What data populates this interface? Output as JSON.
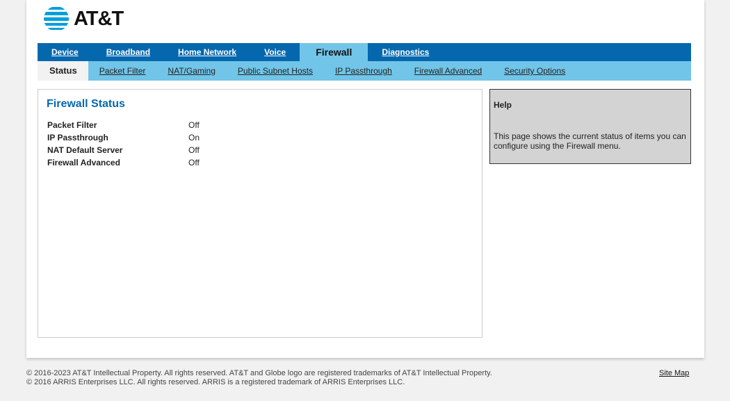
{
  "brand": {
    "name": "AT&T"
  },
  "nav": [
    {
      "label": "Device"
    },
    {
      "label": "Broadband"
    },
    {
      "label": "Home Network"
    },
    {
      "label": "Voice"
    },
    {
      "label": "Firewall",
      "active": true
    },
    {
      "label": "Diagnostics"
    }
  ],
  "subnav": [
    {
      "label": "Status",
      "active": true
    },
    {
      "label": "Packet Filter"
    },
    {
      "label": "NAT/Gaming"
    },
    {
      "label": "Public Subnet Hosts"
    },
    {
      "label": "IP Passthrough"
    },
    {
      "label": "Firewall Advanced"
    },
    {
      "label": "Security Options"
    }
  ],
  "main": {
    "title": "Firewall Status",
    "rows": [
      {
        "label": "Packet Filter",
        "value": "Off"
      },
      {
        "label": "IP Passthrough",
        "value": "On"
      },
      {
        "label": "NAT Default Server",
        "value": "Off"
      },
      {
        "label": "Firewall Advanced",
        "value": "Off"
      }
    ]
  },
  "help": {
    "title": "Help",
    "text": "This page shows the current status of items you can configure using the Firewall menu."
  },
  "footer": {
    "line1": "© 2016-2023 AT&T Intellectual Property. All rights reserved. AT&T and Globe logo are registered trademarks of AT&T Intellectual Property.",
    "line2": "© 2016 ARRIS Enterprises LLC. All rights reserved. ARRIS is a registered trademark of ARRIS Enterprises LLC.",
    "site_map": "Site Map"
  },
  "colors": {
    "nav": "#0568ae",
    "subnav": "#71c5e8",
    "title": "#0568ae"
  }
}
